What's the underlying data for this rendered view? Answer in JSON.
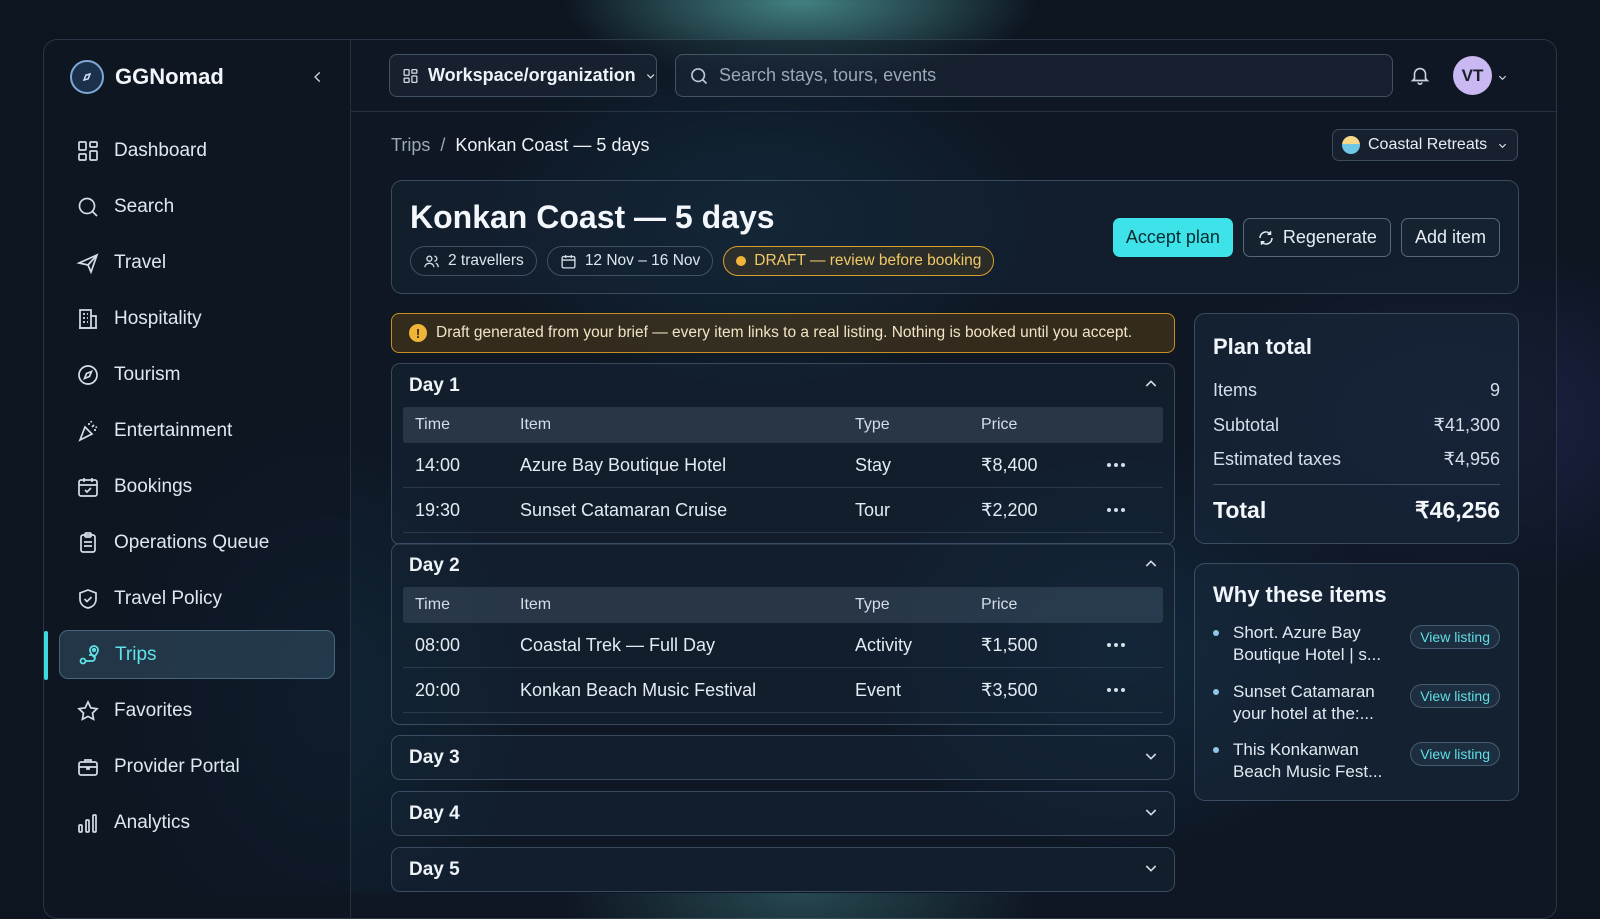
{
  "brand": {
    "name": "GGNomad"
  },
  "sidebar": {
    "items": [
      {
        "label": "Dashboard",
        "icon": "dashboard-icon"
      },
      {
        "label": "Search",
        "icon": "search-icon"
      },
      {
        "label": "Travel",
        "icon": "plane-icon"
      },
      {
        "label": "Hospitality",
        "icon": "building-icon"
      },
      {
        "label": "Tourism",
        "icon": "compass-icon"
      },
      {
        "label": "Entertainment",
        "icon": "party-icon"
      },
      {
        "label": "Bookings",
        "icon": "calendar-check-icon"
      },
      {
        "label": "Operations Queue",
        "icon": "clipboard-icon"
      },
      {
        "label": "Travel Policy",
        "icon": "shield-check-icon"
      },
      {
        "label": "Trips",
        "icon": "route-icon",
        "active": true
      },
      {
        "label": "Favorites",
        "icon": "star-icon"
      },
      {
        "label": "Provider Portal",
        "icon": "briefcase-icon"
      },
      {
        "label": "Analytics",
        "icon": "bar-chart-icon"
      }
    ]
  },
  "topbar": {
    "workspace_label": "Workspace/organization",
    "search_placeholder": "Search stays, tours, events",
    "avatar_initials": "VT"
  },
  "breadcrumb": {
    "parent": "Trips",
    "separator": "/",
    "current": "Konkan Coast — 5 days"
  },
  "collection": {
    "label": "Coastal Retreats"
  },
  "trip": {
    "title": "Konkan Coast — 5 days",
    "travellers": "2 travellers",
    "dates": "12 Nov – 16 Nov",
    "status": "DRAFT — review before booking"
  },
  "actions": {
    "accept": "Accept plan",
    "regenerate": "Regenerate",
    "add": "Add item"
  },
  "alert": {
    "text": "Draft generated from your brief — every item links to a real listing. Nothing is booked until you accept."
  },
  "table_headers": {
    "time": "Time",
    "item": "Item",
    "type": "Type",
    "price": "Price"
  },
  "days": [
    {
      "label": "Day 1",
      "expanded": true,
      "rows": [
        {
          "time": "14:00",
          "item": "Azure Bay Boutique Hotel",
          "type": "Stay",
          "price": "₹8,400"
        },
        {
          "time": "19:30",
          "item": "Sunset Catamaran Cruise",
          "type": "Tour",
          "price": "₹2,200"
        }
      ]
    },
    {
      "label": "Day 2",
      "expanded": true,
      "rows": [
        {
          "time": "08:00",
          "item": "Coastal Trek — Full Day",
          "type": "Activity",
          "price": "₹1,500"
        },
        {
          "time": "20:00",
          "item": "Konkan Beach Music Festival",
          "type": "Event",
          "price": "₹3,500"
        }
      ]
    },
    {
      "label": "Day 3",
      "expanded": false
    },
    {
      "label": "Day 4",
      "expanded": false
    },
    {
      "label": "Day 5",
      "expanded": false
    }
  ],
  "plan_total": {
    "title": "Plan total",
    "items_label": "Items",
    "items_value": "9",
    "subtotal_label": "Subtotal",
    "subtotal_value": "₹41,300",
    "taxes_label": "Estimated taxes",
    "taxes_value": "₹4,956",
    "total_label": "Total",
    "total_value": "₹46,256"
  },
  "why": {
    "title": "Why these items",
    "items": [
      {
        "text1": "Short. Azure Bay",
        "text2": "Boutique Hotel | s...",
        "link": "View listing"
      },
      {
        "text1": "Sunset Catamaran",
        "text2": "your hotel at the:...",
        "link": "View listing"
      },
      {
        "text1": "This Konkanwan",
        "text2": "Beach Music Fest...",
        "link": "View listing"
      }
    ]
  },
  "colors": {
    "accent": "#3ee3ea",
    "draft": "#f0b438",
    "avatar": "#c9b8f2"
  }
}
